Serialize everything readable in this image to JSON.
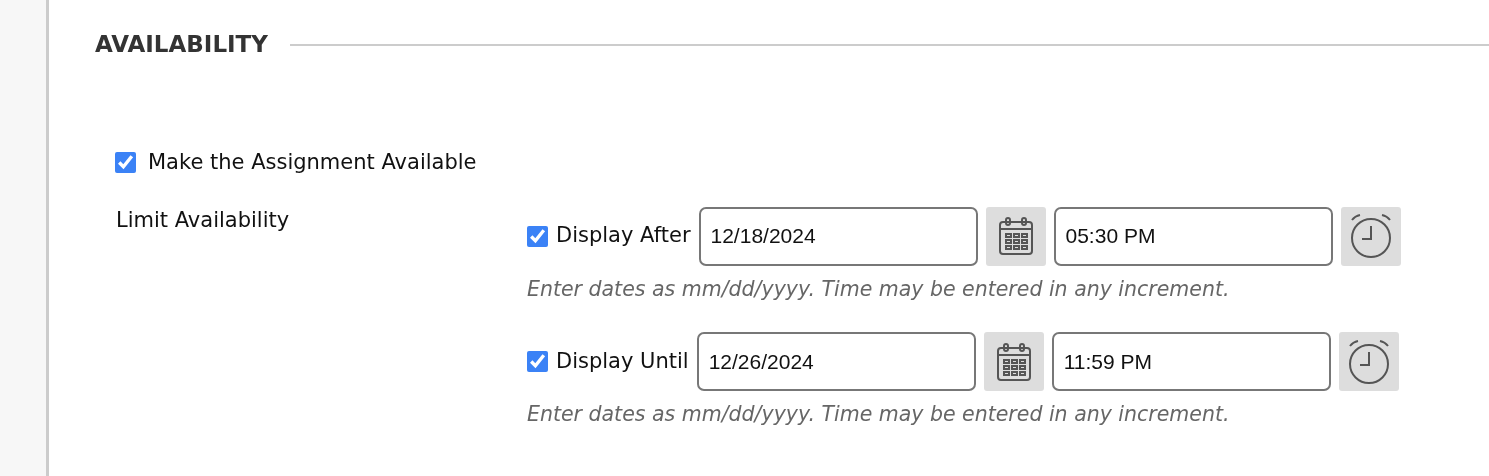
{
  "section": {
    "title": "AVAILABILITY"
  },
  "make_available": {
    "label": "Make the Assignment Available",
    "checked": true
  },
  "limit": {
    "label": "Limit Availability",
    "rows": [
      {
        "label": "Display After",
        "checked": true,
        "date": "12/18/2024",
        "time": "05:30 PM",
        "hint": "Enter dates as mm/dd/yyyy. Time may be entered in any increment."
      },
      {
        "label": "Display Until",
        "checked": true,
        "date": "12/26/2024",
        "time": "11:59 PM",
        "hint": "Enter dates as mm/dd/yyyy. Time may be entered in any increment."
      }
    ]
  }
}
